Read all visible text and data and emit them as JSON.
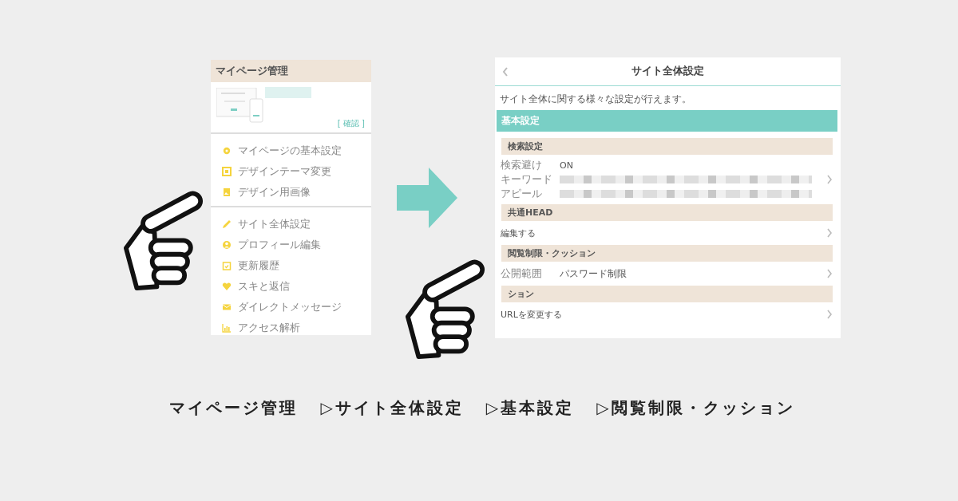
{
  "left_panel": {
    "title": "マイページ管理",
    "confirm_link": "[ 確認 ]",
    "menu_groups": [
      [
        {
          "label": "マイページの基本設定"
        },
        {
          "label": "デザインテーマ変更"
        },
        {
          "label": "デザイン用画像"
        }
      ],
      [
        {
          "label": "サイト全体設定"
        },
        {
          "label": "プロフィール編集"
        },
        {
          "label": "更新履歴"
        },
        {
          "label": "スキと返信"
        },
        {
          "label": "ダイレクトメッセージ"
        },
        {
          "label": "アクセス解析"
        }
      ]
    ]
  },
  "right_panel": {
    "title": "サイト全体設定",
    "description": "サイト全体に関する様々な設定が行えます。",
    "section": "基本設定",
    "groups": [
      {
        "title": "検索設定",
        "kind": "fields",
        "rows": [
          {
            "label": "検索避け",
            "value": "ON"
          },
          {
            "label": "キーワード"
          },
          {
            "label": "アピール"
          }
        ]
      },
      {
        "title": "共通HEAD",
        "kind": "link",
        "label": "編集する"
      },
      {
        "title": "閲覧制限・クッション",
        "kind": "field",
        "label": "公開範囲",
        "value": "パスワード制限"
      },
      {
        "title": "ション",
        "kind": "link",
        "label": "URLを変更する"
      }
    ]
  },
  "caption": [
    "マイページ管理",
    "▷サイト全体設定",
    "▷基本設定",
    "▷閲覧制限・クッション"
  ]
}
